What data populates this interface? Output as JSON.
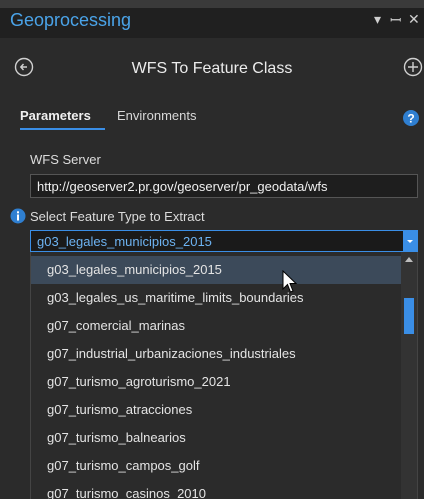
{
  "pane": {
    "title": "Geoprocessing",
    "controls": [
      "▾",
      "ꟷ",
      "✕"
    ]
  },
  "tool": {
    "title": "WFS To Feature Class"
  },
  "tabs": {
    "parameters": "Parameters",
    "environments": "Environments"
  },
  "icons": {
    "back": "back-arrow-icon",
    "add": "add-icon",
    "help": "help-icon",
    "info": "info-icon",
    "dropdown": "chevron-down-icon",
    "scroll": "scroll-up-icon",
    "cursor": "mouse-pointer-icon"
  },
  "colors": {
    "accent": "#3a8ee6",
    "title": "#4aa3e8",
    "background": "#2b2b2b"
  },
  "wfs_server": {
    "label": "WFS Server",
    "value": "http://geoserver2.pr.gov/geoserver/pr_geodata/wfs"
  },
  "feature_type": {
    "label": "Select Feature Type to Extract",
    "selected": "g03_legales_municipios_2015",
    "options": [
      "g03_legales_municipios_2015",
      "g03_legales_us_maritime_limits_boundaries",
      "g07_comercial_marinas",
      "g07_industrial_urbanizaciones_industriales",
      "g07_turismo_agroturismo_2021",
      "g07_turismo_atracciones",
      "g07_turismo_balnearios",
      "g07_turismo_campos_golf",
      "g07_turismo_casinos_2010"
    ]
  }
}
